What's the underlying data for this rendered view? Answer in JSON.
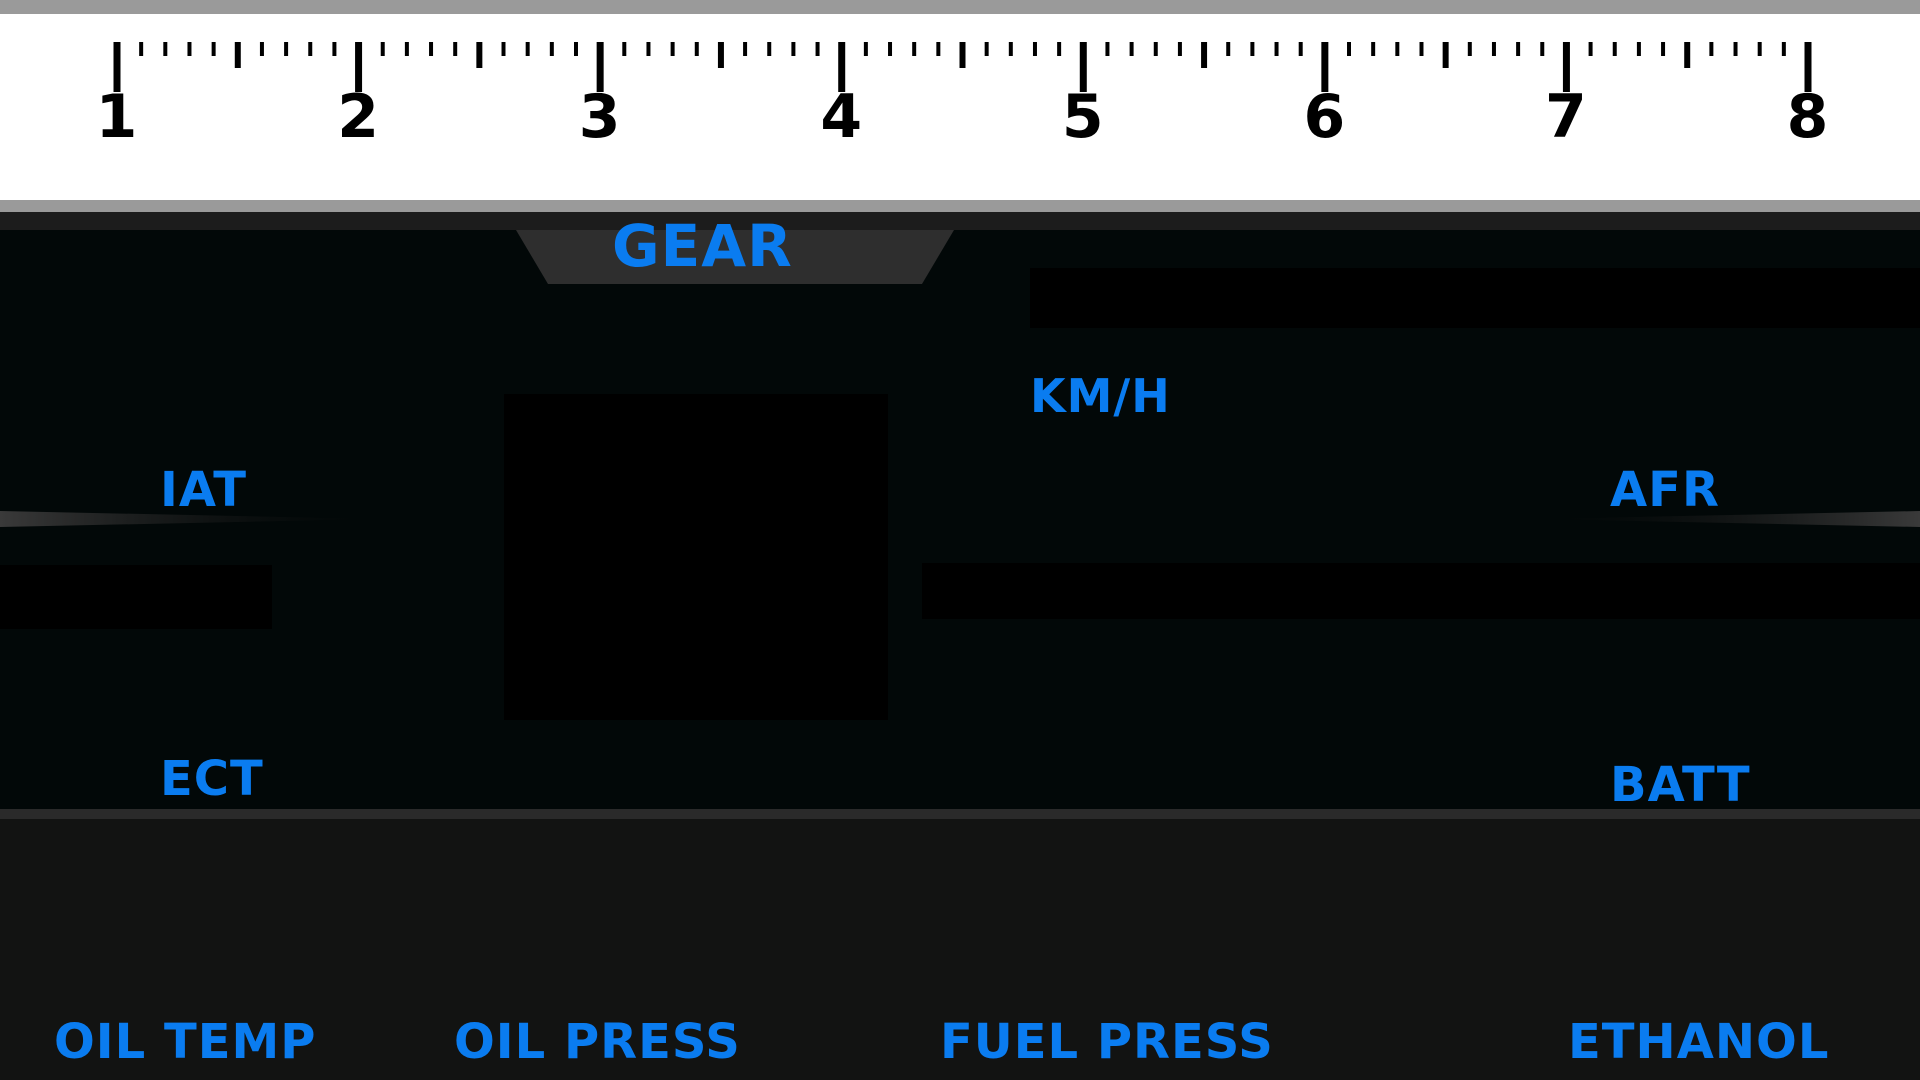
{
  "tachometer": {
    "scale_labels": [
      "1",
      "2",
      "3",
      "4",
      "5",
      "6",
      "7",
      "8"
    ],
    "unit_subdivisions": 10,
    "background_color": "#ffffff",
    "border_color": "#9a9a9a",
    "tick_color": "#000000"
  },
  "gear": {
    "label": "GEAR"
  },
  "speed": {
    "unit_label": "KM/H"
  },
  "left_gauges": {
    "iat_label": "IAT",
    "ect_label": "ECT"
  },
  "right_gauges": {
    "afr_label": "AFR",
    "batt_label": "BATT"
  },
  "bottom_gauges": [
    {
      "label": "OIL TEMP"
    },
    {
      "label": "OIL PRESS"
    },
    {
      "label": "FUEL PRESS"
    },
    {
      "label": "ETHANOL"
    }
  ],
  "colors": {
    "accent": "#0a7cf0",
    "panel_background": "#020808",
    "bottom_background": "#121312",
    "value_box": "#000000"
  }
}
